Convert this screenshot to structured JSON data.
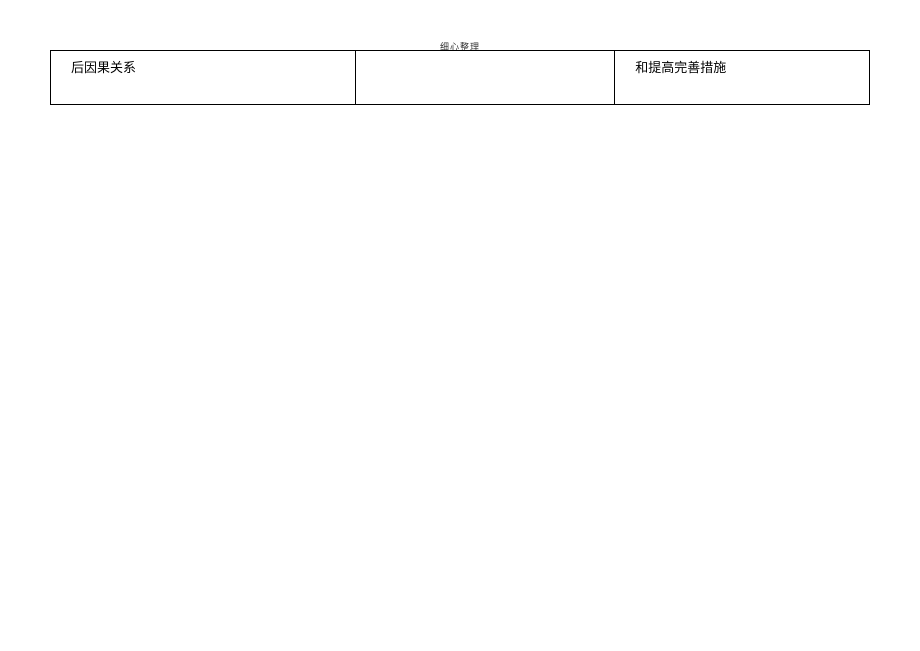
{
  "header": {
    "title": "细心整理"
  },
  "table": {
    "rows": [
      {
        "col1": "后因果关系",
        "col2": "",
        "col3": "和提高完善措施"
      }
    ]
  }
}
